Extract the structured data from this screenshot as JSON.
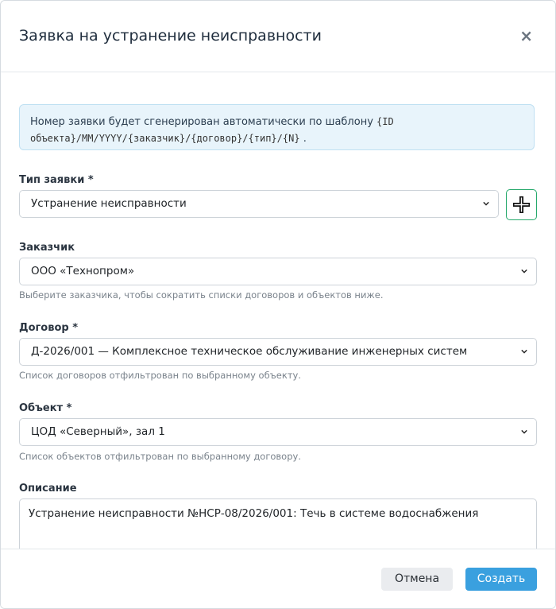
{
  "dialog": {
    "title": "Заявка на устранение неисправности",
    "close_label": "×"
  },
  "info": {
    "text": "Номер заявки будет сгенерирован автоматически по шаблону",
    "template_line1": "{ID",
    "template_line2": "объекта}/MM/YYYY/{заказчик}/{договор}/{тип}/{N}",
    "suffix": "."
  },
  "fields": {
    "type": {
      "label": "Тип заявки *",
      "value": "Устранение неисправности",
      "add_icon": "plus-icon"
    },
    "customer": {
      "label": "Заказчик",
      "value": "ООО «Технопром»",
      "help": "Выберите заказчика, чтобы сократить списки договоров и объектов ниже."
    },
    "contract": {
      "label": "Договор *",
      "value": "Д-2026/001 — Комплексное техническое обслуживание инженерных систем",
      "help": "Список договоров отфильтрован по выбранному объекту."
    },
    "object": {
      "label": "Объект *",
      "value": "ЦОД «Северный», зал 1",
      "help": "Список объектов отфильтрован по выбранному договору."
    },
    "description": {
      "label": "Описание",
      "value": "Устранение неисправности №НСР-08/2026/001: Течь в системе водоснабжения"
    }
  },
  "footer": {
    "cancel_label": "Отмена",
    "create_label": "Создать"
  },
  "colors": {
    "primary": "#3aa0df",
    "success_border": "#26a96c",
    "info_bg": "#e8f4fb"
  }
}
